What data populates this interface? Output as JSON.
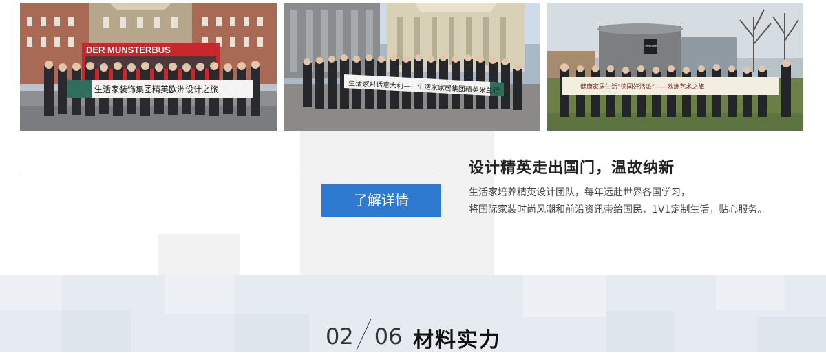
{
  "photos": [
    {
      "alt_icon": "group-photo-icon",
      "bus_text": "DER MUNSTERBUS",
      "banner_logo": "生活家装饰",
      "banner_text": "生活家装饰集团精英欧洲设计之旅"
    },
    {
      "alt_icon": "group-photo-icon",
      "banner_text": "生活家对话意大利——生活家家居集团精英米兰行"
    },
    {
      "alt_icon": "group-photo-icon",
      "banner_text": "健康家居生活“德国好活派”——欧洲艺术之旅",
      "sign_text": "Van Gogh Museum"
    }
  ],
  "feature": {
    "heading": "设计精英走出国门，温故纳新",
    "desc_line1": "生活家培养精英设计团队，每年远赴世界各国学习，",
    "desc_line2": "将国际家装时尚风潮和前沿资讯带给国民，1V1定制生活，贴心服务。",
    "more_label": "了解详情"
  },
  "next_section": {
    "index": "02",
    "total": "06",
    "title": "材料实力"
  },
  "colors": {
    "button": "#2f7ad1",
    "band": "#e6ebf1"
  }
}
